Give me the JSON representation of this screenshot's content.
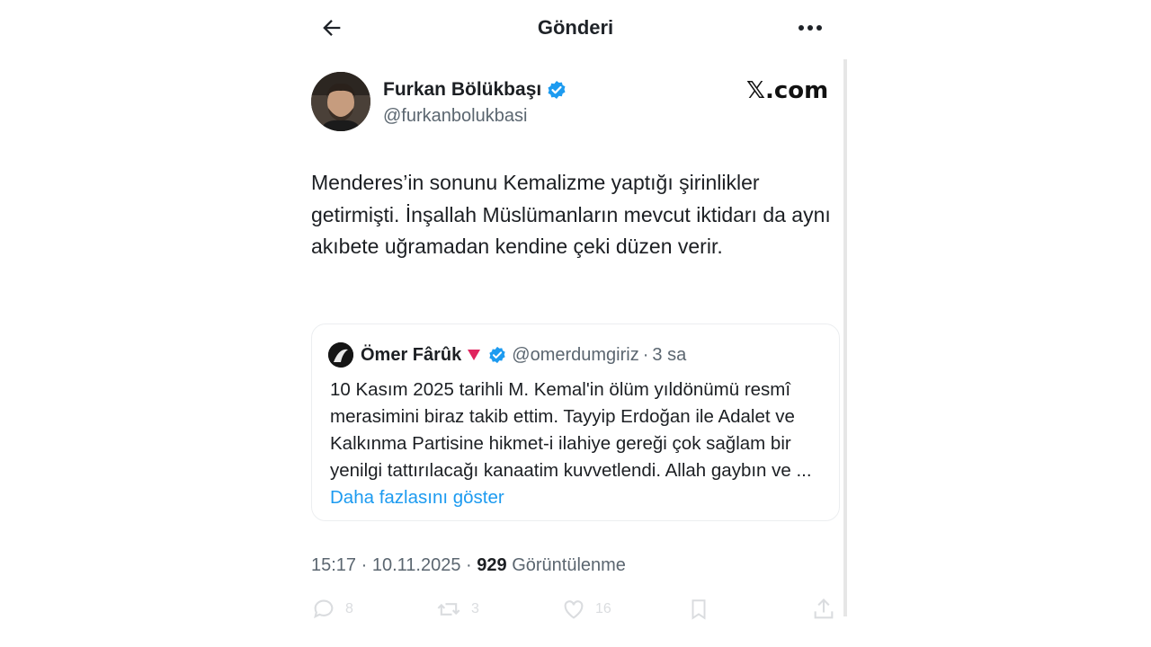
{
  "topbar": {
    "title": "Gönderi"
  },
  "brand": {
    "label": "𝕏.com"
  },
  "post": {
    "author_name": "Furkan Bölükbaşı",
    "author_handle": "@furkanbolukbasi",
    "text": "Menderes’in sonunu Kemalizme yaptığı şirinlikler getirmişti. İnşallah Müslümanların mevcut iktidarı da aynı akıbete uğramadan kendine çeki düzen verir.",
    "time": "15:17",
    "date": "10.11.2025",
    "views_count": "929",
    "views_label": "Görüntülenme"
  },
  "quote": {
    "author_name": "Ömer Fârûk",
    "author_handle": "@omerdumgiriz",
    "age": "3 sa",
    "text": "10 Kasım 2025 tarihli M. Kemal'in ölüm yıldönümü resmî merasimini biraz takib ettim. Tayyip Erdoğan ile Adalet ve Kalkınma Partisine hikmet-i ilahiye gereği çok sağlam bir yenilgi tattırılacağı kanaatim kuvvetlendi. Allah gaybın ve ...",
    "show_more": "Daha fazlasını göster"
  },
  "actions": {
    "replies": "8",
    "reposts": "3",
    "likes": "16"
  },
  "colors": {
    "accent": "#1d9bf0",
    "text": "#0f1419",
    "muted": "#5b6670",
    "flag": "#e0245e"
  },
  "icons": [
    "back-arrow-icon",
    "more-options-icon",
    "verified-badge-icon",
    "triangle-flag-icon",
    "reply-icon",
    "repost-icon",
    "like-icon",
    "bookmark-icon",
    "share-icon"
  ]
}
